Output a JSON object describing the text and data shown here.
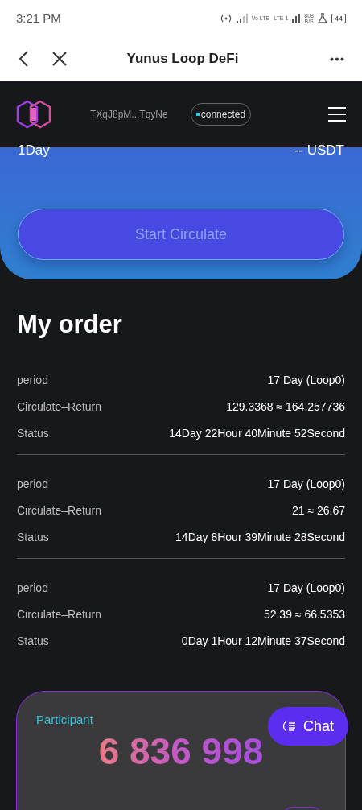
{
  "status_bar": {
    "time": "3:21 PM",
    "volte": "Vo LTE",
    "lte": "LTE 1",
    "speed": "808",
    "speed_unit": "B/S",
    "battery": "44"
  },
  "header": {
    "title": "Yunus Loop DeFi"
  },
  "app_bar": {
    "address": "TXqJ8pM...TqyNe",
    "connection": {
      "label": "connected",
      "on": true
    }
  },
  "circulate_card": {
    "period": "1Day",
    "amount": "-- USDT",
    "button": "Start Circulate"
  },
  "my_order": {
    "title": "My order",
    "orders": [
      {
        "rows": [
          {
            "label": "period",
            "value": "17 Day (Loop0)"
          },
          {
            "label": "Circulate–Return",
            "value": "129.3368 ≈ 164.257736"
          },
          {
            "label": "Status",
            "value": "14Day 22Hour 40Minute 52Second"
          }
        ]
      },
      {
        "rows": [
          {
            "label": "period",
            "value": "17 Day (Loop0)"
          },
          {
            "label": "Circulate–Return",
            "value": "21 ≈ 26.67"
          },
          {
            "label": "Status",
            "value": "14Day 8Hour 39Minute 28Second"
          }
        ]
      },
      {
        "rows": [
          {
            "label": "period",
            "value": "17 Day (Loop0)"
          },
          {
            "label": "Circulate–Return",
            "value": "52.39 ≈ 66.5353"
          },
          {
            "label": "Status",
            "value": "0Day 1Hour 12Minute 37Second"
          }
        ]
      }
    ]
  },
  "participant_card": {
    "label": "Participant",
    "count": "6 836 998"
  },
  "chat_button": {
    "label": "Chat"
  }
}
